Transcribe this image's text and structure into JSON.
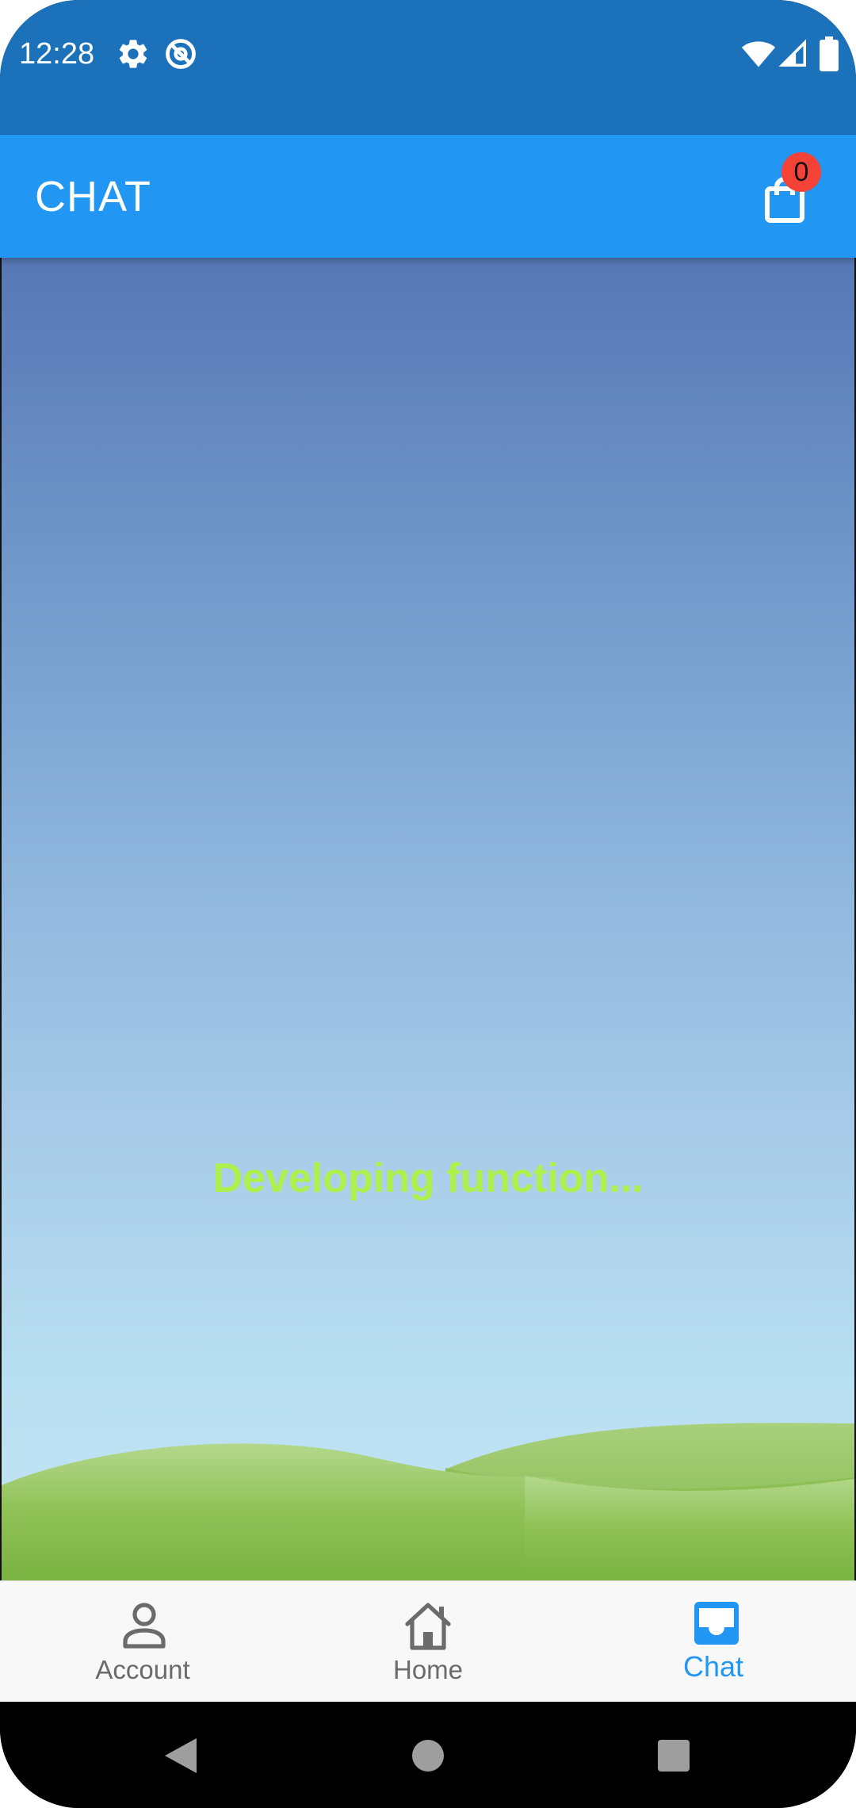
{
  "status_bar": {
    "time": "12:28",
    "left_icons": [
      "gear-icon",
      "sync-icon"
    ],
    "right_icons": [
      "wifi-icon",
      "signal-icon",
      "battery-icon"
    ]
  },
  "app_bar": {
    "title": "CHAT",
    "cart_icon": "shopping-bag-icon",
    "cart_badge_count": "0",
    "colors": {
      "background": "#2196f3",
      "badge": "#f44336"
    }
  },
  "content": {
    "message": "Developing function...",
    "message_color": "#b0f04c"
  },
  "bottom_nav": {
    "items": [
      {
        "label": "Account",
        "icon": "person-icon",
        "active": false
      },
      {
        "label": "Home",
        "icon": "home-icon",
        "active": false
      },
      {
        "label": "Chat",
        "icon": "inbox-icon",
        "active": true
      }
    ],
    "active_color": "#2196f3",
    "inactive_color": "#6b6b6b"
  },
  "system_nav": {
    "buttons": [
      "back-icon",
      "home-circle-icon",
      "recents-icon"
    ]
  }
}
